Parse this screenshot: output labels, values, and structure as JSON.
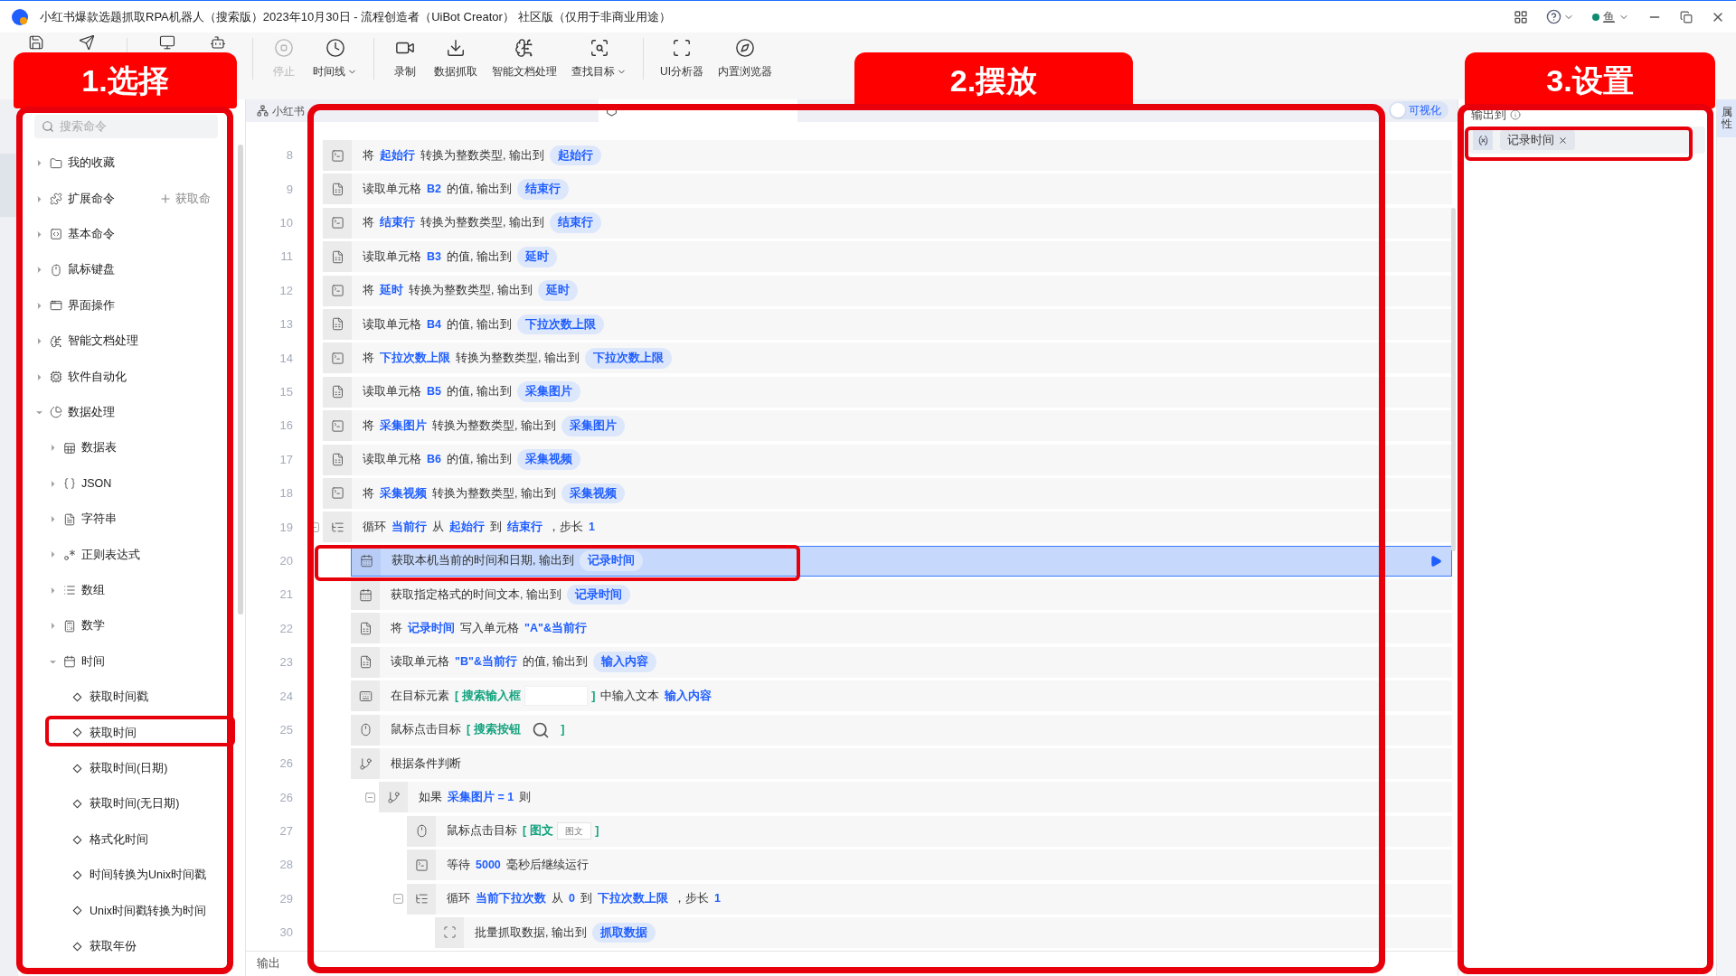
{
  "window": {
    "title": "小红书爆款选题抓取RPA机器人（搜索版）2023年10月30日 - 流程创造者（UiBot Creator） 社区版（仅用于非商业用途）",
    "user": "鱼"
  },
  "toolbar": [
    [
      {
        "kind": "save"
      },
      {
        "kind": "send"
      }
    ],
    [
      {
        "kind": "monitor"
      },
      {
        "kind": "robot"
      }
    ],
    [
      {
        "kind": "stop",
        "label": "停止",
        "disabled": true,
        "dropdown": false
      },
      {
        "kind": "clock",
        "label": "时间线",
        "disabled": false,
        "dropdown": true
      }
    ],
    [
      {
        "kind": "record",
        "label": "录制",
        "disabled": false,
        "dropdown": false
      },
      {
        "kind": "grab",
        "label": "数据抓取",
        "disabled": false,
        "dropdown": false
      },
      {
        "kind": "ai",
        "label": "智能文档处理",
        "disabled": false,
        "dropdown": false
      },
      {
        "kind": "find",
        "label": "查找目标",
        "disabled": false,
        "dropdown": true
      }
    ],
    [
      {
        "kind": "ui",
        "label": "UI分析器",
        "disabled": false,
        "dropdown": false
      },
      {
        "kind": "browser",
        "label": "内置浏览器",
        "disabled": false,
        "dropdown": false
      }
    ]
  ],
  "annotations": [
    {
      "text": "1.选择"
    },
    {
      "text": "2.摆放"
    },
    {
      "text": "3.设置"
    }
  ],
  "commands": {
    "search": {
      "placeholder": "搜索命令"
    },
    "tree": [
      {
        "label": "我的收藏",
        "kind": "folder",
        "expanded": false
      },
      {
        "label": "扩展命令",
        "kind": "ext",
        "expanded": false,
        "action": "获取命"
      },
      {
        "label": "基本命令",
        "kind": "code",
        "expanded": false
      },
      {
        "label": "鼠标键盘",
        "kind": "mousekb",
        "expanded": false
      },
      {
        "label": "界面操作",
        "kind": "window",
        "expanded": false
      },
      {
        "label": "智能文档处理",
        "kind": "ai",
        "expanded": false
      },
      {
        "label": "软件自动化",
        "kind": "auto",
        "expanded": false
      },
      {
        "label": "数据处理",
        "kind": "pie",
        "expanded": true,
        "children": [
          {
            "label": "数据表",
            "kind": "table",
            "expanded": false
          },
          {
            "label": "JSON",
            "kind": "json",
            "expanded": false
          },
          {
            "label": "字符串",
            "kind": "string",
            "expanded": false
          },
          {
            "label": "正则表达式",
            "kind": "regex",
            "expanded": false
          },
          {
            "label": "数组",
            "kind": "array",
            "expanded": false
          },
          {
            "label": "数学",
            "kind": "math",
            "expanded": false
          },
          {
            "label": "时间",
            "kind": "time",
            "expanded": true,
            "children": [
              {
                "label": "获取时间戳"
              },
              {
                "label": "获取时间"
              },
              {
                "label": "获取时间(日期)"
              },
              {
                "label": "获取时间(无日期)"
              },
              {
                "label": "格式化时间"
              },
              {
                "label": "时间转换为Unix时间戳"
              },
              {
                "label": "Unix时间戳转换为时间"
              },
              {
                "label": "获取年份"
              }
            ]
          }
        ]
      }
    ]
  },
  "editor": {
    "tabs": [
      {
        "label": "小红书",
        "selected": false
      },
      {
        "selected": true
      }
    ],
    "visualize": {
      "label": "可视化",
      "on": false
    },
    "rows": [
      {
        "number": "8",
        "kind": "convert",
        "selected": false,
        "parts": [
          {
            "kind": "text",
            "text": "将"
          },
          {
            "kind": "var",
            "text": "起始行"
          },
          {
            "kind": "text",
            "text": "转换为整数类型, 输出到"
          },
          {
            "kind": "tag",
            "text": "起始行"
          }
        ]
      },
      {
        "number": "9",
        "kind": "excel",
        "selected": false,
        "parts": [
          {
            "kind": "text",
            "text": "读取单元格"
          },
          {
            "kind": "var",
            "text": "B2"
          },
          {
            "kind": "text",
            "text": "的值, 输出到"
          },
          {
            "kind": "tag",
            "text": "结束行"
          }
        ]
      },
      {
        "number": "10",
        "kind": "convert",
        "selected": false,
        "parts": [
          {
            "kind": "text",
            "text": "将"
          },
          {
            "kind": "var",
            "text": "结束行"
          },
          {
            "kind": "text",
            "text": "转换为整数类型, 输出到"
          },
          {
            "kind": "tag",
            "text": "结束行"
          }
        ]
      },
      {
        "number": "11",
        "kind": "excel",
        "selected": false,
        "parts": [
          {
            "kind": "text",
            "text": "读取单元格"
          },
          {
            "kind": "var",
            "text": "B3"
          },
          {
            "kind": "text",
            "text": "的值, 输出到"
          },
          {
            "kind": "tag",
            "text": "延时"
          }
        ]
      },
      {
        "number": "12",
        "kind": "convert",
        "selected": false,
        "parts": [
          {
            "kind": "text",
            "text": "将"
          },
          {
            "kind": "var",
            "text": "延时"
          },
          {
            "kind": "text",
            "text": "转换为整数类型, 输出到"
          },
          {
            "kind": "tag",
            "text": "延时"
          }
        ]
      },
      {
        "number": "13",
        "kind": "excel",
        "selected": false,
        "parts": [
          {
            "kind": "text",
            "text": "读取单元格"
          },
          {
            "kind": "var",
            "text": "B4"
          },
          {
            "kind": "text",
            "text": "的值, 输出到"
          },
          {
            "kind": "tag",
            "text": "下拉次数上限"
          }
        ]
      },
      {
        "number": "14",
        "kind": "convert",
        "selected": false,
        "parts": [
          {
            "kind": "text",
            "text": "将"
          },
          {
            "kind": "var",
            "text": "下拉次数上限"
          },
          {
            "kind": "text",
            "text": "转换为整数类型, 输出到"
          },
          {
            "kind": "tag",
            "text": "下拉次数上限"
          }
        ]
      },
      {
        "number": "15",
        "kind": "excel",
        "selected": false,
        "parts": [
          {
            "kind": "text",
            "text": "读取单元格"
          },
          {
            "kind": "var",
            "text": "B5"
          },
          {
            "kind": "text",
            "text": "的值, 输出到"
          },
          {
            "kind": "tag",
            "text": "采集图片"
          }
        ]
      },
      {
        "number": "16",
        "kind": "convert",
        "selected": false,
        "parts": [
          {
            "kind": "text",
            "text": "将"
          },
          {
            "kind": "var",
            "text": "采集图片"
          },
          {
            "kind": "text",
            "text": "转换为整数类型, 输出到"
          },
          {
            "kind": "tag",
            "text": "采集图片"
          }
        ]
      },
      {
        "number": "17",
        "kind": "excel",
        "selected": false,
        "parts": [
          {
            "kind": "text",
            "text": "读取单元格"
          },
          {
            "kind": "var",
            "text": "B6"
          },
          {
            "kind": "text",
            "text": "的值, 输出到"
          },
          {
            "kind": "tag",
            "text": "采集视频"
          }
        ]
      },
      {
        "number": "18",
        "kind": "convert",
        "selected": false,
        "parts": [
          {
            "kind": "text",
            "text": "将"
          },
          {
            "kind": "var",
            "text": "采集视频"
          },
          {
            "kind": "text",
            "text": "转换为整数类型, 输出到"
          },
          {
            "kind": "tag",
            "text": "采集视频"
          }
        ]
      },
      {
        "number": "19",
        "kind": "loop",
        "selected": false,
        "expanded": true,
        "parts": [
          {
            "kind": "text",
            "text": "循环"
          },
          {
            "kind": "var",
            "text": "当前行"
          },
          {
            "kind": "text",
            "text": "从"
          },
          {
            "kind": "var",
            "text": "起始行"
          },
          {
            "kind": "text",
            "text": "到"
          },
          {
            "kind": "var",
            "text": "结束行"
          },
          {
            "kind": "text",
            "text": "，步长"
          },
          {
            "kind": "var",
            "text": "1"
          }
        ],
        "children": [
          {
            "number": "20",
            "kind": "calendar",
            "selected": true,
            "parts": [
              {
                "kind": "text",
                "text": "获取本机当前的时间和日期, 输出到"
              },
              {
                "kind": "tag",
                "text": "记录时间"
              }
            ]
          },
          {
            "number": "21",
            "kind": "calendar",
            "selected": false,
            "parts": [
              {
                "kind": "text",
                "text": "获取指定格式的时间文本, 输出到"
              },
              {
                "kind": "tag",
                "text": "记录时间"
              }
            ]
          },
          {
            "number": "22",
            "kind": "excel",
            "selected": false,
            "parts": [
              {
                "kind": "text",
                "text": "将"
              },
              {
                "kind": "var",
                "text": "记录时间"
              },
              {
                "kind": "text",
                "text": "写入单元格"
              },
              {
                "kind": "var",
                "text": "\"A\"&当前行"
              }
            ]
          },
          {
            "number": "23",
            "kind": "excel",
            "selected": false,
            "parts": [
              {
                "kind": "text",
                "text": "读取单元格"
              },
              {
                "kind": "var",
                "text": "\"B\"&当前行"
              },
              {
                "kind": "text",
                "text": "的值, 输出到"
              },
              {
                "kind": "tag",
                "text": "输入内容"
              }
            ]
          },
          {
            "number": "24",
            "kind": "keyboard",
            "selected": false,
            "parts": [
              {
                "kind": "text",
                "text": "在目标元素"
              },
              {
                "kind": "target_field",
                "open": "[",
                "text": "搜索输入框",
                "close": "]"
              },
              {
                "kind": "text",
                "text": "中输入文本"
              },
              {
                "kind": "var",
                "text": "输入内容"
              }
            ]
          },
          {
            "number": "25",
            "kind": "mouse",
            "selected": false,
            "parts": [
              {
                "kind": "text",
                "text": "鼠标点击目标"
              },
              {
                "kind": "target_button",
                "open": "[",
                "text": "搜索按钮",
                "close": "]"
              }
            ]
          },
          {
            "number": "26",
            "kind": "branch",
            "selected": false,
            "parts": [
              {
                "kind": "text",
                "text": "根据条件判断"
              }
            ],
            "children": [
              {
                "number": "26",
                "kind": "branch",
                "selected": false,
                "expanded": true,
                "parts": [
                  {
                    "kind": "text",
                    "text": "如果"
                  },
                  {
                    "kind": "var",
                    "text": "采集图片 = 1"
                  },
                  {
                    "kind": "text",
                    "text": "则"
                  }
                ],
                "children": [
                  {
                    "number": "27",
                    "kind": "mouse",
                    "selected": false,
                    "parts": [
                      {
                        "kind": "text",
                        "text": "鼠标点击目标"
                      },
                      {
                        "kind": "target",
                        "open": "[",
                        "text": "图文",
                        "preview_text": "图文",
                        "close": "]"
                      }
                    ]
                  },
                  {
                    "number": "28",
                    "kind": "convert",
                    "selected": false,
                    "parts": [
                      {
                        "kind": "text",
                        "text": "等待"
                      },
                      {
                        "kind": "var",
                        "text": "5000"
                      },
                      {
                        "kind": "text",
                        "text": "毫秒后继续运行"
                      }
                    ]
                  },
                  {
                    "number": "29",
                    "kind": "loop",
                    "selected": false,
                    "expanded": true,
                    "parts": [
                      {
                        "kind": "text",
                        "text": "循环"
                      },
                      {
                        "kind": "var",
                        "text": "当前下拉次数"
                      },
                      {
                        "kind": "text",
                        "text": "从"
                      },
                      {
                        "kind": "var",
                        "text": "0"
                      },
                      {
                        "kind": "text",
                        "text": "到"
                      },
                      {
                        "kind": "var",
                        "text": "下拉次数上限"
                      },
                      {
                        "kind": "text",
                        "text": "，步长"
                      },
                      {
                        "kind": "var",
                        "text": "1"
                      }
                    ],
                    "children": [
                      {
                        "number": "30",
                        "kind": "grab",
                        "selected": false,
                        "parts": [
                          {
                            "kind": "text",
                            "text": "批量抓取数据, 输出到"
                          },
                          {
                            "kind": "tag",
                            "text": "抓取数据"
                          }
                        ]
                      }
                    ]
                  }
                ]
              }
            ]
          }
        ]
      }
    ],
    "output_bar": "输出"
  },
  "properties": {
    "tab": "属性",
    "label": "输出到",
    "tags": [
      "记录时间"
    ]
  }
}
